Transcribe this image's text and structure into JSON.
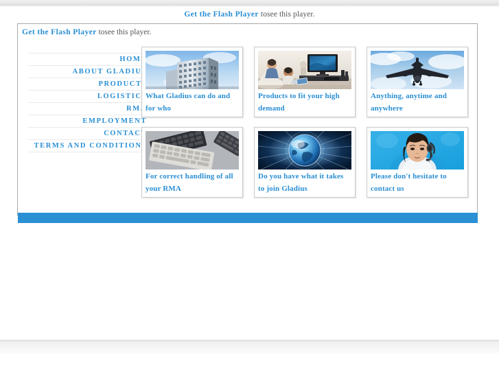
{
  "flash_notice": {
    "link_text": "Get the Flash Player",
    "rest_text": " tosee this player."
  },
  "nav": {
    "items": [
      {
        "label": "HOME",
        "name": "home"
      },
      {
        "label": "ABOUT GLADIUS",
        "name": "about-gladius"
      },
      {
        "label": "PRODUCTS",
        "name": "products"
      },
      {
        "label": "LOGISTICS",
        "name": "logistics"
      },
      {
        "label": "RMA",
        "name": "rma"
      },
      {
        "label": "EMPLOYMENT",
        "name": "employment"
      },
      {
        "label": "CONTACT",
        "name": "contact"
      },
      {
        "label": "TERMS AND CONDITIONS",
        "name": "terms-and-conditions"
      }
    ]
  },
  "cards": [
    {
      "caption": "What Gladius can do and for who",
      "image": "office-building-photo"
    },
    {
      "caption": "Products to fit your high demand",
      "image": "living-room-tv-photo"
    },
    {
      "caption": "Anything, anytime and anywhere",
      "image": "airplane-sky-photo"
    },
    {
      "caption": "For correct handling of all your RMA",
      "image": "keyboards-pile-photo"
    },
    {
      "caption": "Do you have what it takes to join Gladius",
      "image": "blue-globe-photo"
    },
    {
      "caption": "Please don't hesitate to contact us",
      "image": "call-center-agent-photo"
    }
  ],
  "colors": {
    "accent_blue": "#2a8fd4",
    "footer_blue": "#2a90d4",
    "border_gray": "#a8a8a8"
  }
}
